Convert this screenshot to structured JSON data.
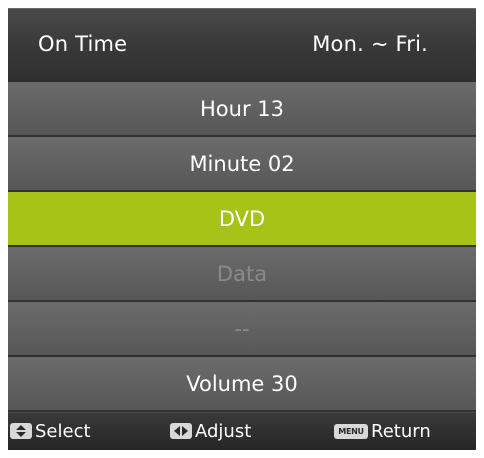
{
  "header": {
    "title": "On Time",
    "days": "Mon. ~ Fri."
  },
  "menu": {
    "items": [
      {
        "label": "Hour 13",
        "state": "normal"
      },
      {
        "label": "Minute 02",
        "state": "normal"
      },
      {
        "label": "DVD",
        "state": "selected"
      },
      {
        "label": "Data",
        "state": "disabled"
      },
      {
        "label": "--",
        "state": "disabled"
      },
      {
        "label": "Volume 30",
        "state": "normal"
      }
    ]
  },
  "footer": {
    "select_label": "Select",
    "adjust_label": "Adjust",
    "return_label": "Return",
    "menu_key": "MENU",
    "select_icon": "up-down-arrows-icon",
    "adjust_icon": "left-right-arrows-icon"
  },
  "colors": {
    "accent_selected": "#a7c317",
    "row_background": "#5f5f5f",
    "disabled_text": "#8a8a8a"
  }
}
